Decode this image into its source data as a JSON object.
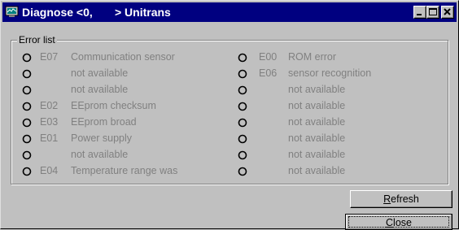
{
  "window": {
    "title": "Diagnose <0,       > Unitrans",
    "icon": "diagnostic-app-icon"
  },
  "group": {
    "label": "Error list"
  },
  "left_column": [
    {
      "code": "E07",
      "desc": "Communication sensor"
    },
    {
      "code": "",
      "desc": "not available"
    },
    {
      "code": "",
      "desc": "not available"
    },
    {
      "code": "E02",
      "desc": "EEprom checksum"
    },
    {
      "code": "E03",
      "desc": "EEprom broad"
    },
    {
      "code": "E01",
      "desc": "Power supply"
    },
    {
      "code": "",
      "desc": "not available"
    },
    {
      "code": "E04",
      "desc": "Temperature range was"
    }
  ],
  "right_column": [
    {
      "code": "E00",
      "desc": "ROM error"
    },
    {
      "code": "E06",
      "desc": "sensor recognition"
    },
    {
      "code": "",
      "desc": "not available"
    },
    {
      "code": "",
      "desc": "not available"
    },
    {
      "code": "",
      "desc": "not available"
    },
    {
      "code": "",
      "desc": "not available"
    },
    {
      "code": "",
      "desc": "not available"
    },
    {
      "code": "",
      "desc": "not available"
    }
  ],
  "buttons": {
    "refresh_prefix": "",
    "refresh_mnemonic": "R",
    "refresh_rest": "efresh",
    "close_mnemonic": "C",
    "close_rest": "lose"
  },
  "colors": {
    "titlebar": "#000080",
    "face": "#c0c0c0",
    "disabled_text": "#808080"
  }
}
